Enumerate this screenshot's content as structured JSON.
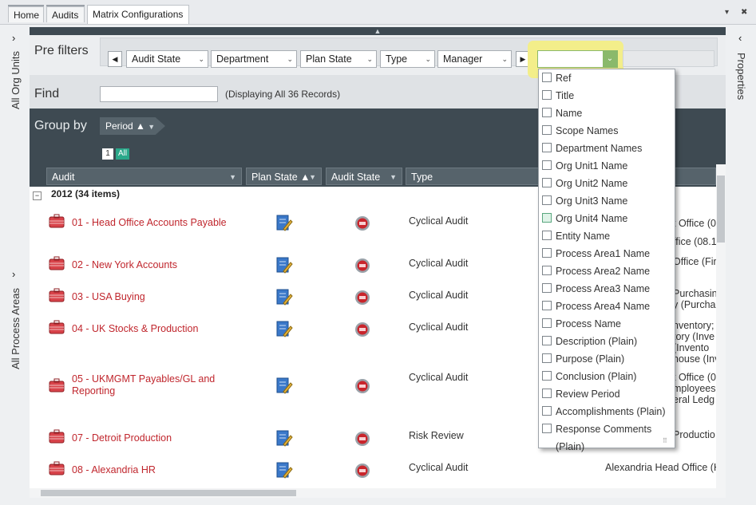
{
  "tabs": [
    {
      "label": "Home"
    },
    {
      "label": "Audits"
    },
    {
      "label": "Matrix Configurations"
    }
  ],
  "window_controls": {
    "dropdown": "▾",
    "close": "✖"
  },
  "left_panels": {
    "org_units": "All Org Units",
    "process_areas": "All Process Areas",
    "expand_glyph": "›"
  },
  "right_panel": {
    "label": "Properties",
    "collapse_glyph": "‹"
  },
  "prefilters": {
    "label": "Pre filters",
    "filters": [
      "Audit State",
      "Department",
      "Plan State",
      "Type",
      "Manager"
    ]
  },
  "find": {
    "label": "Find",
    "value": "",
    "status": "(Displaying All 36 Records)"
  },
  "groupby": {
    "label": "Group by",
    "chip": "Period ▲"
  },
  "paging": {
    "page": "1",
    "all": "All"
  },
  "columns": {
    "audit": "Audit",
    "plan_state": "Plan State ▲",
    "audit_state": "Audit State",
    "type": "Type"
  },
  "group": {
    "title": "2012 (34 items)"
  },
  "rows": [
    {
      "audit": "01 - Head Office Accounts Payable",
      "type": "Cyclical Audit",
      "org": "t Office (0",
      "org2": "ffice (08.1"
    },
    {
      "audit": "02 - New York Accounts",
      "type": "Cyclical Audit",
      "org": "Office (Fir",
      "org2": ""
    },
    {
      "audit": "03 - USA Buying",
      "type": "Cyclical Audit",
      "org": "Purchasin",
      "org2": "y (Purcha"
    },
    {
      "audit": "04 - UK Stocks & Production",
      "type": "Cyclical Audit",
      "org": "nventory;",
      "org2": "tory (Inve",
      "org3": "(Invento",
      "org4": "house (Inv"
    },
    {
      "audit": "05 - UKMGMT Payables/GL and",
      "audit2": "Reporting",
      "type": "Cyclical Audit",
      "org": "t Office (0",
      "org2": "mployees",
      "org3": "eral Ledg"
    },
    {
      "audit": "07 - Detroit Production",
      "type": "Risk Review",
      "org": "Productio"
    },
    {
      "audit": "08 - Alexandria HR",
      "type": "Cyclical Audit",
      "org": "Alexandria Head Office (H"
    }
  ],
  "popup_options": [
    {
      "label": "Ref",
      "checked": false
    },
    {
      "label": "Title",
      "checked": false
    },
    {
      "label": "Name",
      "checked": false
    },
    {
      "label": "Scope Names",
      "checked": false
    },
    {
      "label": "Department Names",
      "checked": false
    },
    {
      "label": "Org Unit1 Name",
      "checked": false
    },
    {
      "label": "Org Unit2 Name",
      "checked": false
    },
    {
      "label": "Org Unit3 Name",
      "checked": false
    },
    {
      "label": "Org Unit4 Name",
      "checked": false,
      "hover": true
    },
    {
      "label": "Entity Name",
      "checked": false
    },
    {
      "label": "Process Area1 Name",
      "checked": false
    },
    {
      "label": "Process Area2 Name",
      "checked": false
    },
    {
      "label": "Process Area3 Name",
      "checked": false
    },
    {
      "label": "Process Area4 Name",
      "checked": false
    },
    {
      "label": "Process Name",
      "checked": false
    },
    {
      "label": "Description (Plain)",
      "checked": false
    },
    {
      "label": "Purpose (Plain)",
      "checked": false
    },
    {
      "label": "Conclusion (Plain)",
      "checked": false
    },
    {
      "label": "Review Period",
      "checked": false
    },
    {
      "label": "Accomplishments (Plain)",
      "checked": false
    },
    {
      "label": "Response Comments (Plain)",
      "checked": false
    }
  ],
  "colors": {
    "accent_green": "#2aa88a",
    "link_red": "#c0262d",
    "header_dark": "#3e4a52",
    "highlight_yellow": "#f3ee8a"
  }
}
